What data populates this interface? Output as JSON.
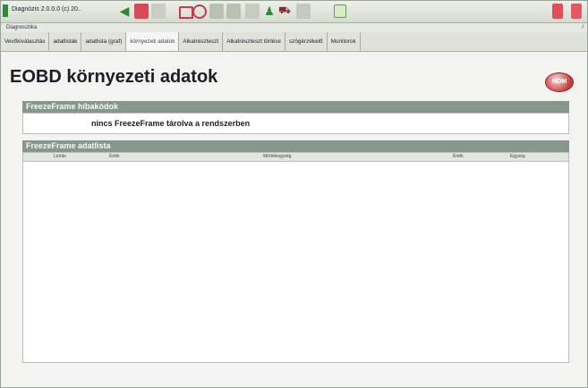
{
  "toolbar": {
    "title": "Diagnózis 2.0.0.0 (c) 20.."
  },
  "breadcrumb": {
    "path": "Diagnosztika",
    "separator": "/"
  },
  "tabs": [
    {
      "label": "Vevőkiválasztás"
    },
    {
      "label": "adatlisták"
    },
    {
      "label": "adatlista (graf)"
    },
    {
      "label": "környezeti adatok"
    },
    {
      "label": "Alkatrészteszt"
    },
    {
      "label": "Alkatrészteszt törlése"
    },
    {
      "label": "szögérzékelő"
    },
    {
      "label": "Monitorok"
    }
  ],
  "page": {
    "title": "EOBD környezeti adatok",
    "nom_label": "NOM"
  },
  "sections": {
    "freeze_errors": {
      "header": "FreezeFrame hibakódok",
      "message": "nincs FreezeFrame tárolva a rendszerben"
    },
    "freeze_list": {
      "header": "FreezeFrame adatlista",
      "columns": [
        "Leírás",
        "Érték",
        "Mértékegység",
        "Érték",
        "Egység"
      ]
    }
  }
}
